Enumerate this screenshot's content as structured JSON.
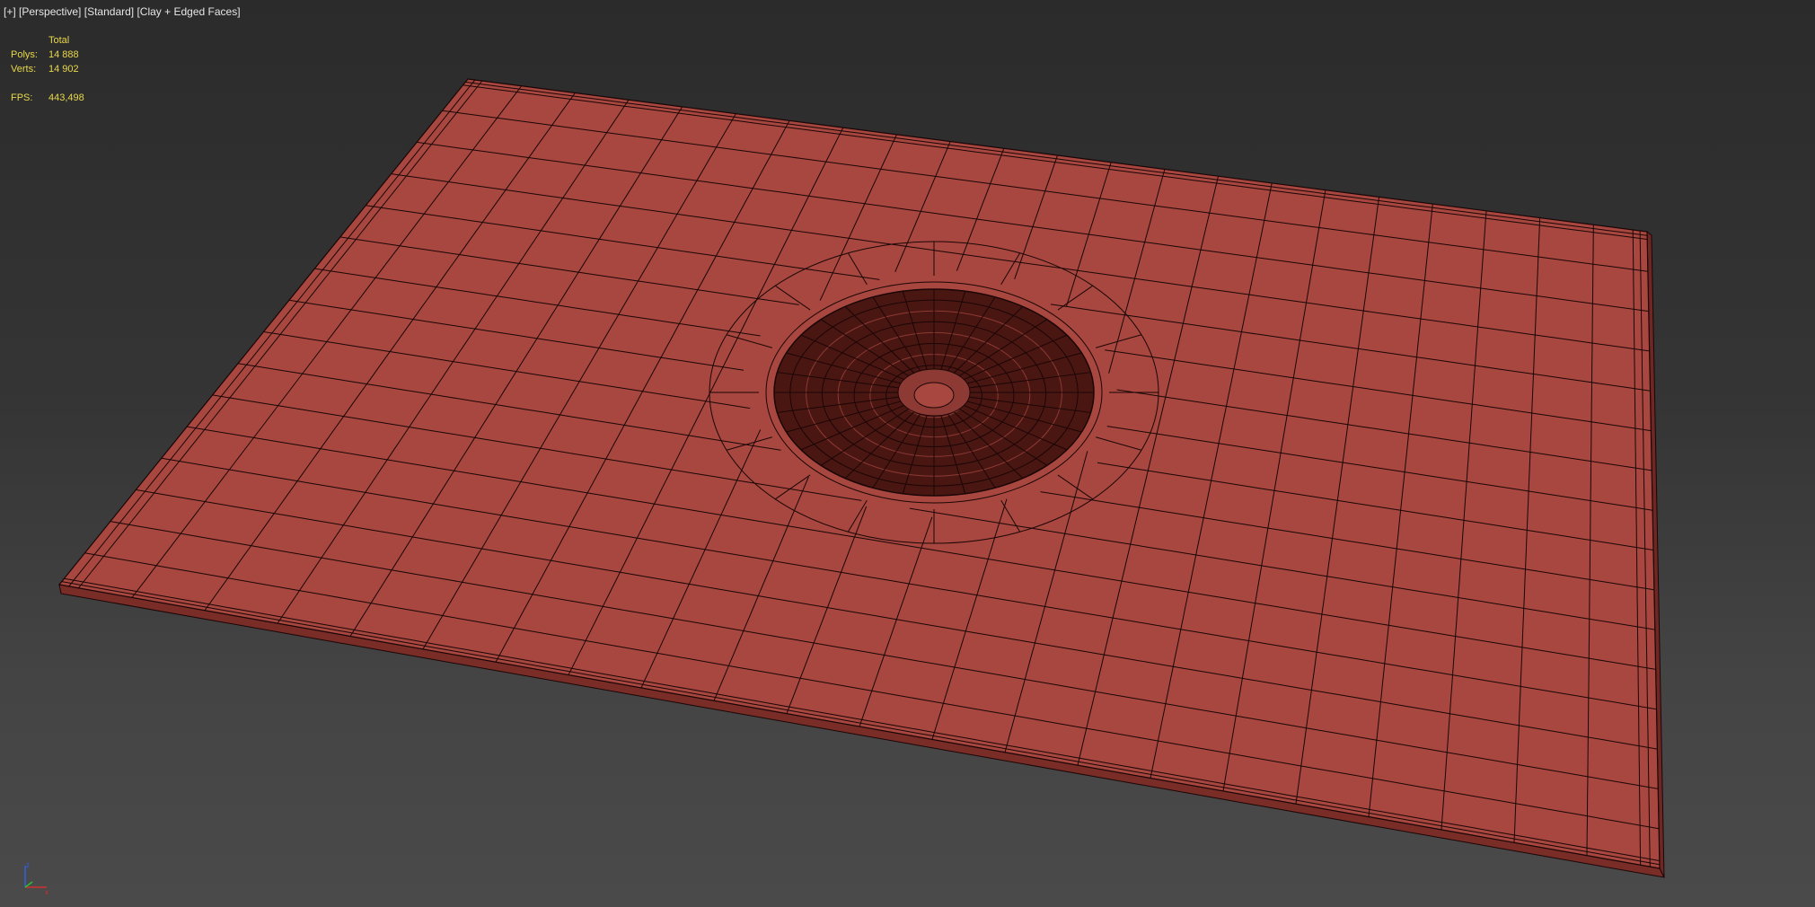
{
  "viewport": {
    "labels": [
      "[+]",
      "[Perspective]",
      "[Standard]",
      "[Clay + Edged Faces]"
    ]
  },
  "stats": {
    "header": "Total",
    "polys_label": "Polys:",
    "polys_value": "14 888",
    "verts_label": "Verts:",
    "verts_value": "14 902",
    "fps_label": "FPS:",
    "fps_value": "443,498"
  },
  "gizmo": {
    "z_label": "z",
    "x_label": "x"
  },
  "colors": {
    "mesh_fill": "#a8473f",
    "mesh_edge": "#1a0606",
    "stats_text": "#e8d84a",
    "label_text": "#e6e6e6",
    "axis_x": "#d03030",
    "axis_y": "#30c030",
    "axis_z": "#3060e0"
  }
}
